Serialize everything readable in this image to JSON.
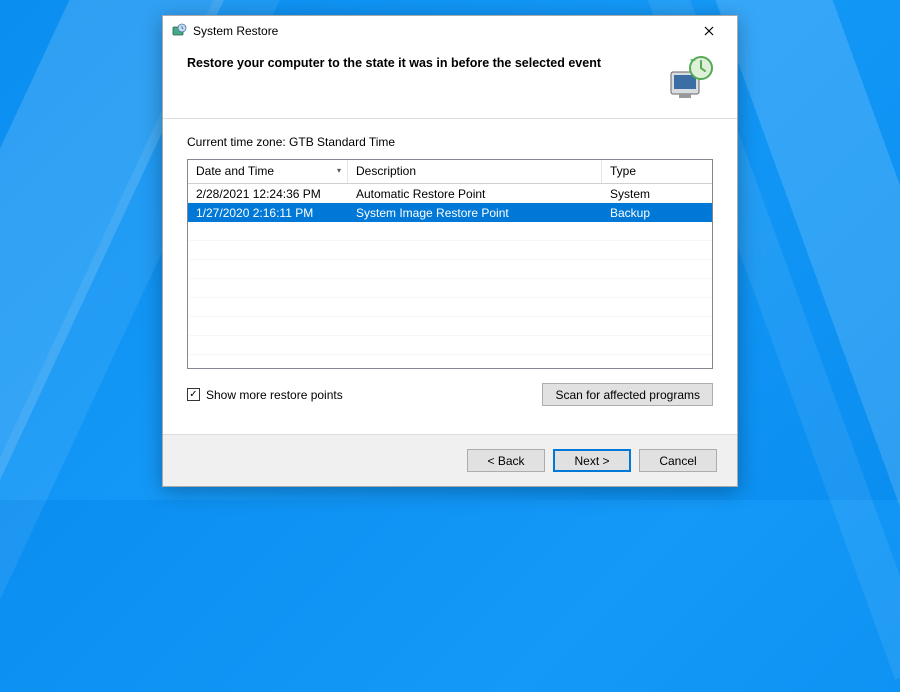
{
  "window": {
    "title": "System Restore"
  },
  "header": {
    "heading": "Restore your computer to the state it was in before the selected event"
  },
  "timezone": {
    "label": "Current time zone: GTB Standard Time"
  },
  "grid": {
    "columns": {
      "date": "Date and Time",
      "description": "Description",
      "type": "Type"
    },
    "rows": [
      {
        "date": "2/28/2021 12:24:36 PM",
        "description": "Automatic Restore Point",
        "type": "System",
        "selected": false
      },
      {
        "date": "1/27/2020 2:16:11 PM",
        "description": "System Image Restore Point",
        "type": "Backup",
        "selected": true
      }
    ]
  },
  "options": {
    "show_more_label": "Show more restore points",
    "show_more_checked": true,
    "scan_label": "Scan for affected programs"
  },
  "buttons": {
    "back": "< Back",
    "next": "Next >",
    "cancel": "Cancel"
  }
}
